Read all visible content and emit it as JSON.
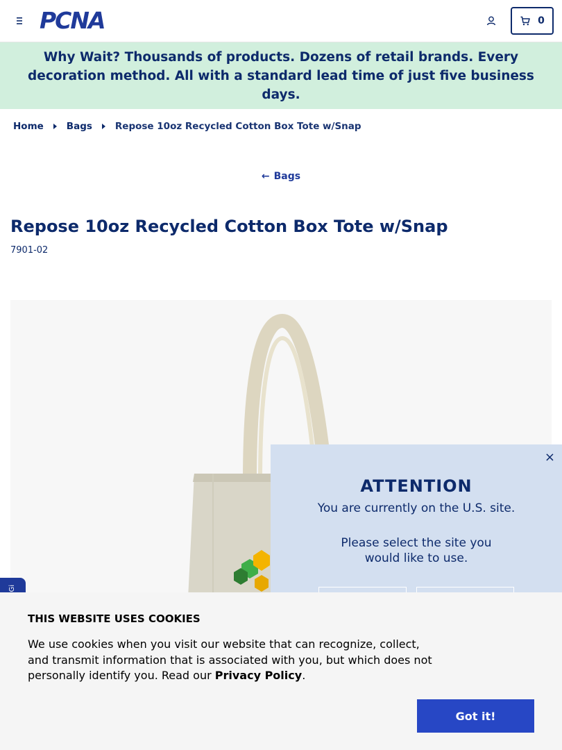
{
  "header": {
    "logo_text": "PCNA",
    "cart_count": "0"
  },
  "promo": {
    "lead": "Why Wait?",
    "text": " Thousands of products. Dozens of retail brands. Every decoration method. All with a standard lead time of just five business days."
  },
  "breadcrumb": {
    "items": [
      "Home",
      "Bags"
    ],
    "current": "Repose 10oz Recycled Cotton Box Tote w/Snap"
  },
  "back_link": "Bags",
  "product": {
    "title": "Repose 10oz Recycled Cotton Box Tote w/Snap",
    "sku": "7901-02"
  },
  "side_tab": {
    "label": "Gi"
  },
  "modal": {
    "close": "×",
    "title": "ATTENTION",
    "subtitle": "You are currently on the U.S. site.",
    "prompt": "Please select the site you would like to use."
  },
  "cookie": {
    "title": "THIS WEBSITE USES COOKIES",
    "text": "We use cookies when you visit our website that can recognize, collect, and transmit information that is associated with you, but which does not personally identify you. Read our ",
    "link": "Privacy Policy",
    "end": ".",
    "button": "Got it!"
  },
  "colors": {
    "brand_navy": "#0d2a6b",
    "brand_blue": "#1f3a9a",
    "promo_bg": "#d1efdd",
    "modal_bg": "#d3dff0",
    "button_blue": "#2747c5"
  }
}
